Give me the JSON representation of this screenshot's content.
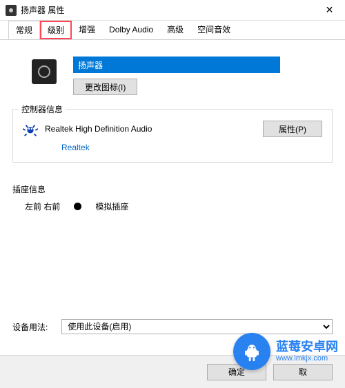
{
  "window": {
    "title": "扬声器 属性"
  },
  "tabs": [
    {
      "label": "常规",
      "active": true,
      "highlight": false
    },
    {
      "label": "级别",
      "active": false,
      "highlight": true
    },
    {
      "label": "增强",
      "active": false,
      "highlight": false
    },
    {
      "label": "Dolby Audio",
      "active": false,
      "highlight": false
    },
    {
      "label": "高级",
      "active": false,
      "highlight": false
    },
    {
      "label": "空间音效",
      "active": false,
      "highlight": false
    }
  ],
  "general": {
    "device_name": "扬声器",
    "change_icon_btn": "更改图标(I)"
  },
  "controller": {
    "group_label": "控制器信息",
    "name": "Realtek High Definition Audio",
    "manufacturer": "Realtek",
    "properties_btn": "属性(P)"
  },
  "jack": {
    "group_label": "插座信息",
    "location": "左前 右前",
    "type": "模拟插座",
    "dot_color": "#000000"
  },
  "usage": {
    "label": "设备用法:",
    "selected": "使用此设备(启用)"
  },
  "footer": {
    "ok": "确定",
    "cancel": "取"
  },
  "watermark": {
    "name": "蓝莓安卓网",
    "url": "www.lmkjx.com"
  }
}
